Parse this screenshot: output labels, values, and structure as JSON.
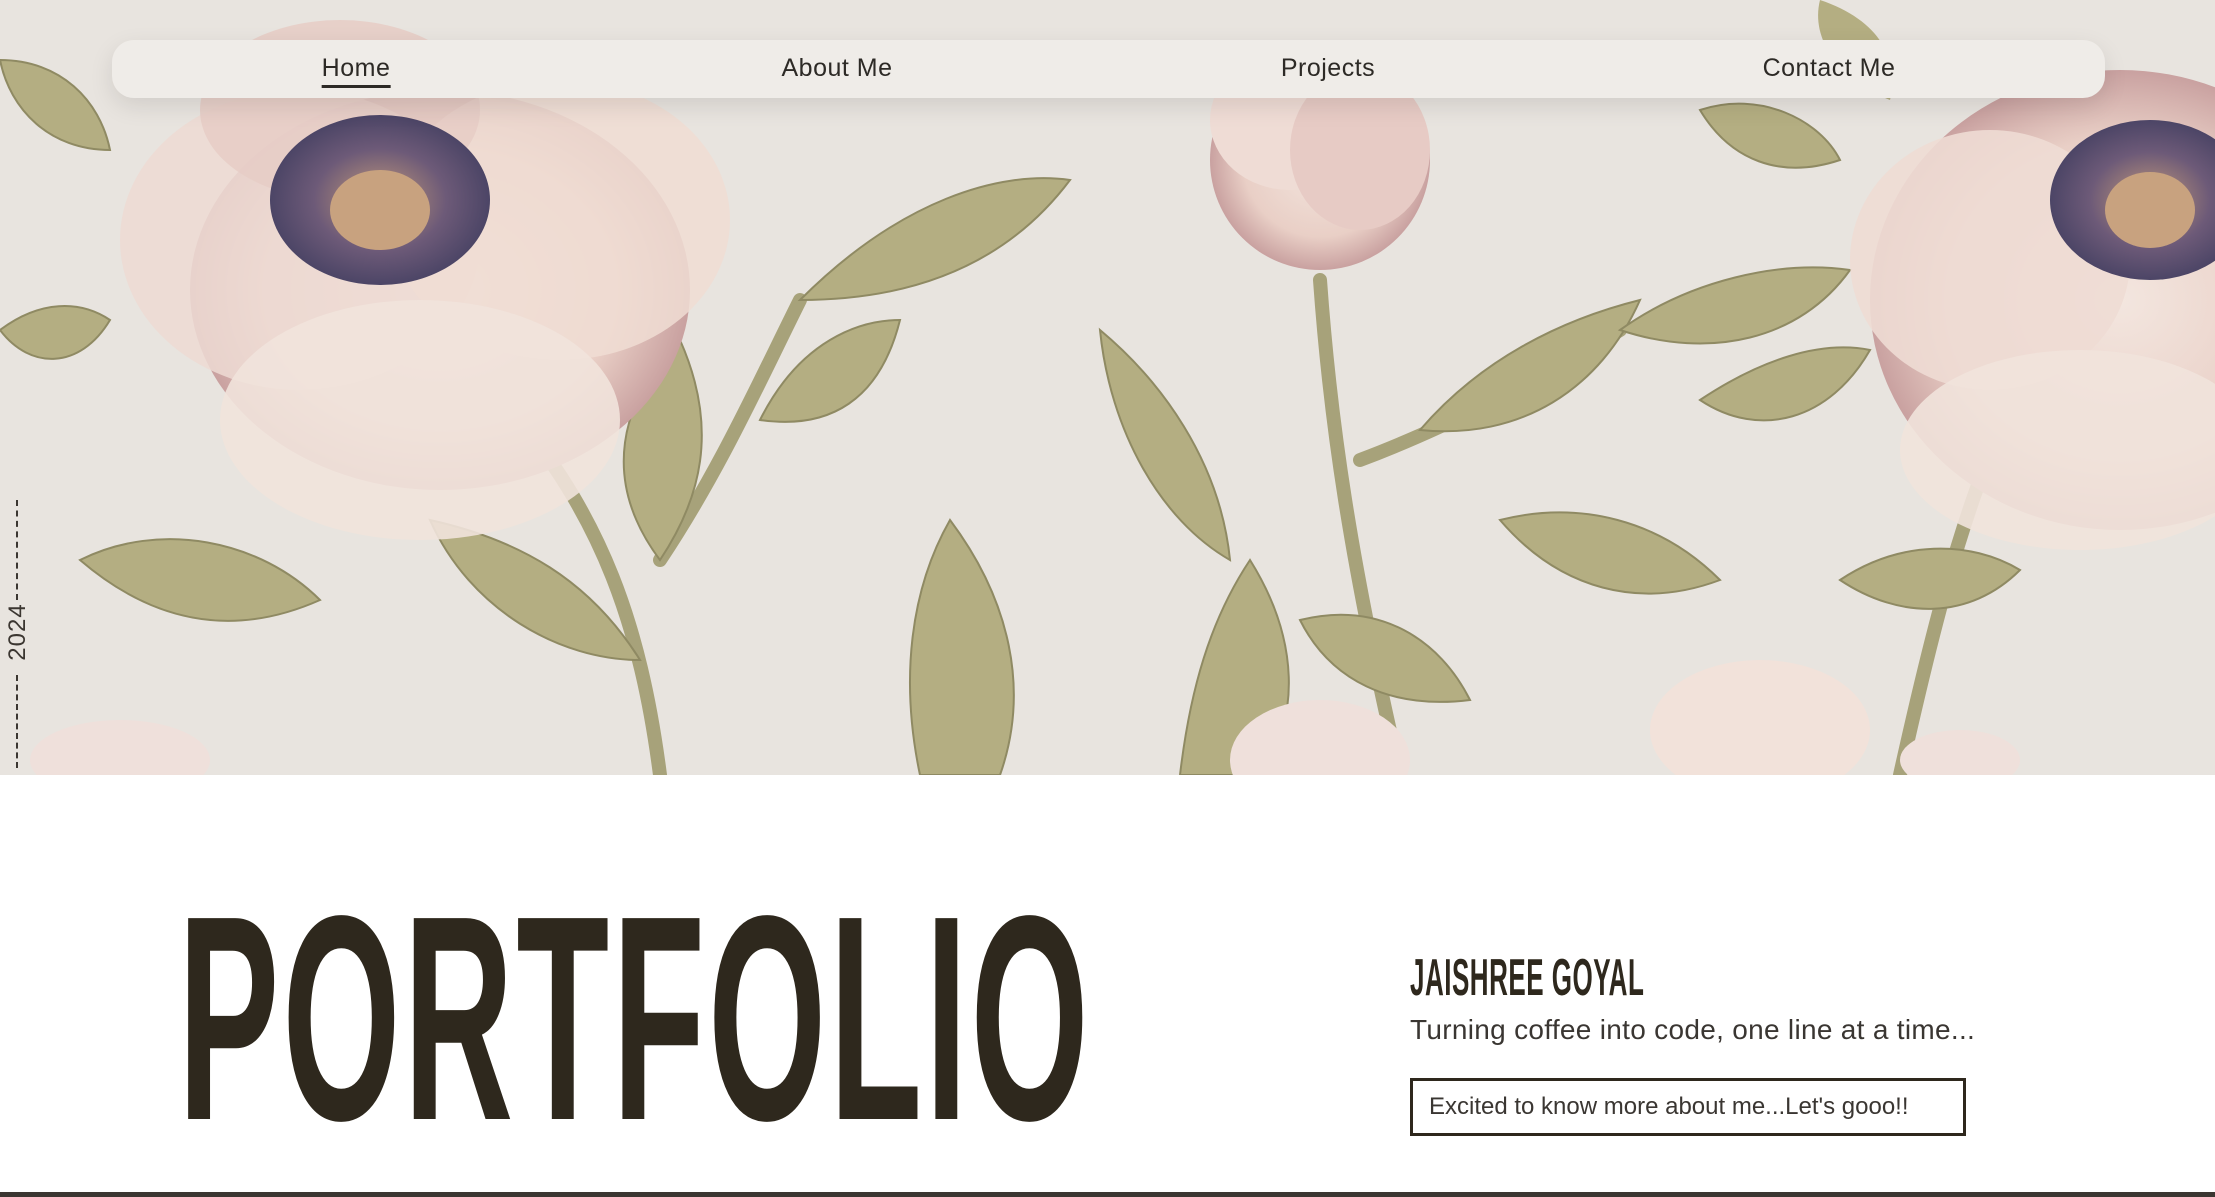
{
  "nav": {
    "items": [
      {
        "label": "Home",
        "active": true
      },
      {
        "label": "About Me",
        "active": false
      },
      {
        "label": "Projects",
        "active": false
      },
      {
        "label": "Contact Me",
        "active": false
      }
    ]
  },
  "hero": {
    "year": "2024",
    "background": "floral-peony-pattern"
  },
  "main": {
    "title": "PORTFOLIO",
    "name": "JAISHREE GOYAL",
    "tagline": "Turning coffee into code, one line at a time...",
    "cta_label": "Excited to know more about me...Let's gooo!!"
  },
  "colors": {
    "hero_bg": "#e8e4df",
    "nav_bg": "#efece8",
    "text_dark": "#2e281d",
    "petal": "#ecd6cf",
    "leaf": "#aeab7f"
  }
}
